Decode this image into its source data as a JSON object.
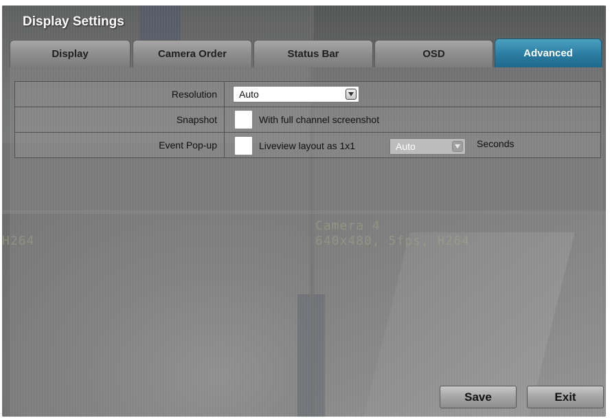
{
  "window": {
    "title": "Display Settings"
  },
  "tabs": [
    {
      "label": "Display",
      "active": false
    },
    {
      "label": "Camera Order",
      "active": false
    },
    {
      "label": "Status Bar",
      "active": false
    },
    {
      "label": "OSD",
      "active": false
    },
    {
      "label": "Advanced",
      "active": true
    }
  ],
  "settings": {
    "resolution": {
      "label": "Resolution",
      "value": "Auto"
    },
    "snapshot": {
      "label": "Snapshot",
      "checkbox_checked": false,
      "checkbox_label": "With full channel screenshot"
    },
    "event_popup": {
      "label": "Event Pop-up",
      "checkbox_checked": false,
      "checkbox_label": "Liveview layout as 1x1",
      "duration_value": "Auto",
      "duration_enabled": false,
      "unit_label": "Seconds"
    }
  },
  "buttons": {
    "save": "Save",
    "exit": "Exit"
  },
  "background": {
    "camera_left_caption": "H264",
    "camera_right_name": "Camera 4",
    "camera_right_info": "640x480, 5fps, H264"
  },
  "colors": {
    "active_tab": "#2a7ca0",
    "tab": "#8e8e8e",
    "panel": "#6f706f"
  },
  "icons": {
    "dropdown": "chevron-down-icon"
  }
}
